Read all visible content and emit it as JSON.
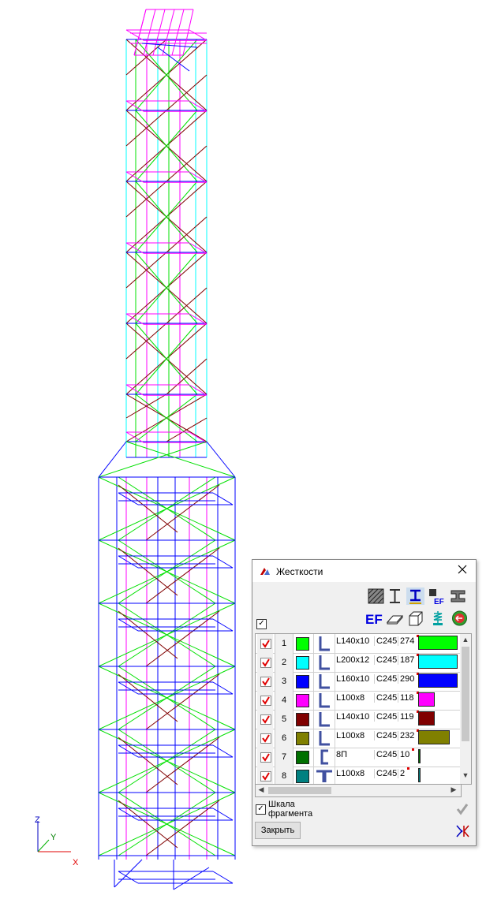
{
  "axes": {
    "z": "Z",
    "y": "Y",
    "x": "X"
  },
  "colors": {
    "green": "#00e000",
    "cyan": "#00ffff",
    "blue": "#0000ff",
    "magenta": "#ff00ff",
    "maroon": "#800000",
    "olive": "#808000",
    "darkgreen": "#007000",
    "teal": "#008080"
  },
  "dialog": {
    "title": "Жесткости",
    "toolbar_icons": [
      "hatched-section-icon",
      "i-beam-icon",
      "i-beam-selected-icon",
      "ef-small-icon",
      "channel-section-icon",
      "ef-icon",
      "plate-icon",
      "solid-icon",
      "spring-icon",
      "back-arrow-icon"
    ],
    "rows": [
      {
        "num": "1",
        "color": "#00ff00",
        "shape": "angle",
        "section": "L140x10",
        "material": "C245",
        "count": "274",
        "fill": 1.0
      },
      {
        "num": "2",
        "color": "#00ffff",
        "shape": "angle",
        "section": "L200x12",
        "material": "C245",
        "count": "187",
        "fill": 1.0
      },
      {
        "num": "3",
        "color": "#0000ff",
        "shape": "angle",
        "section": "L160x10",
        "material": "C245",
        "count": "290",
        "fill": 1.0
      },
      {
        "num": "4",
        "color": "#ff00ff",
        "shape": "angle",
        "section": "L100x8",
        "material": "C245",
        "count": "118",
        "fill": 0.41
      },
      {
        "num": "5",
        "color": "#800000",
        "shape": "angle",
        "section": "L140x10",
        "material": "C245",
        "count": "119",
        "fill": 0.41
      },
      {
        "num": "6",
        "color": "#808000",
        "shape": "angle",
        "section": "L100x8",
        "material": "C245",
        "count": "232",
        "fill": 0.8
      },
      {
        "num": "7",
        "color": "#007000",
        "shape": "channel",
        "section": "8П",
        "material": "C245",
        "count": "10",
        "fill": 0.035
      },
      {
        "num": "8",
        "color": "#008080",
        "shape": "double-angle",
        "section": "L100x8",
        "material": "C245",
        "count": "2",
        "fill": 0.007
      }
    ],
    "scale_label": "Шкала фрагмента",
    "close_label": "Закрыть"
  }
}
